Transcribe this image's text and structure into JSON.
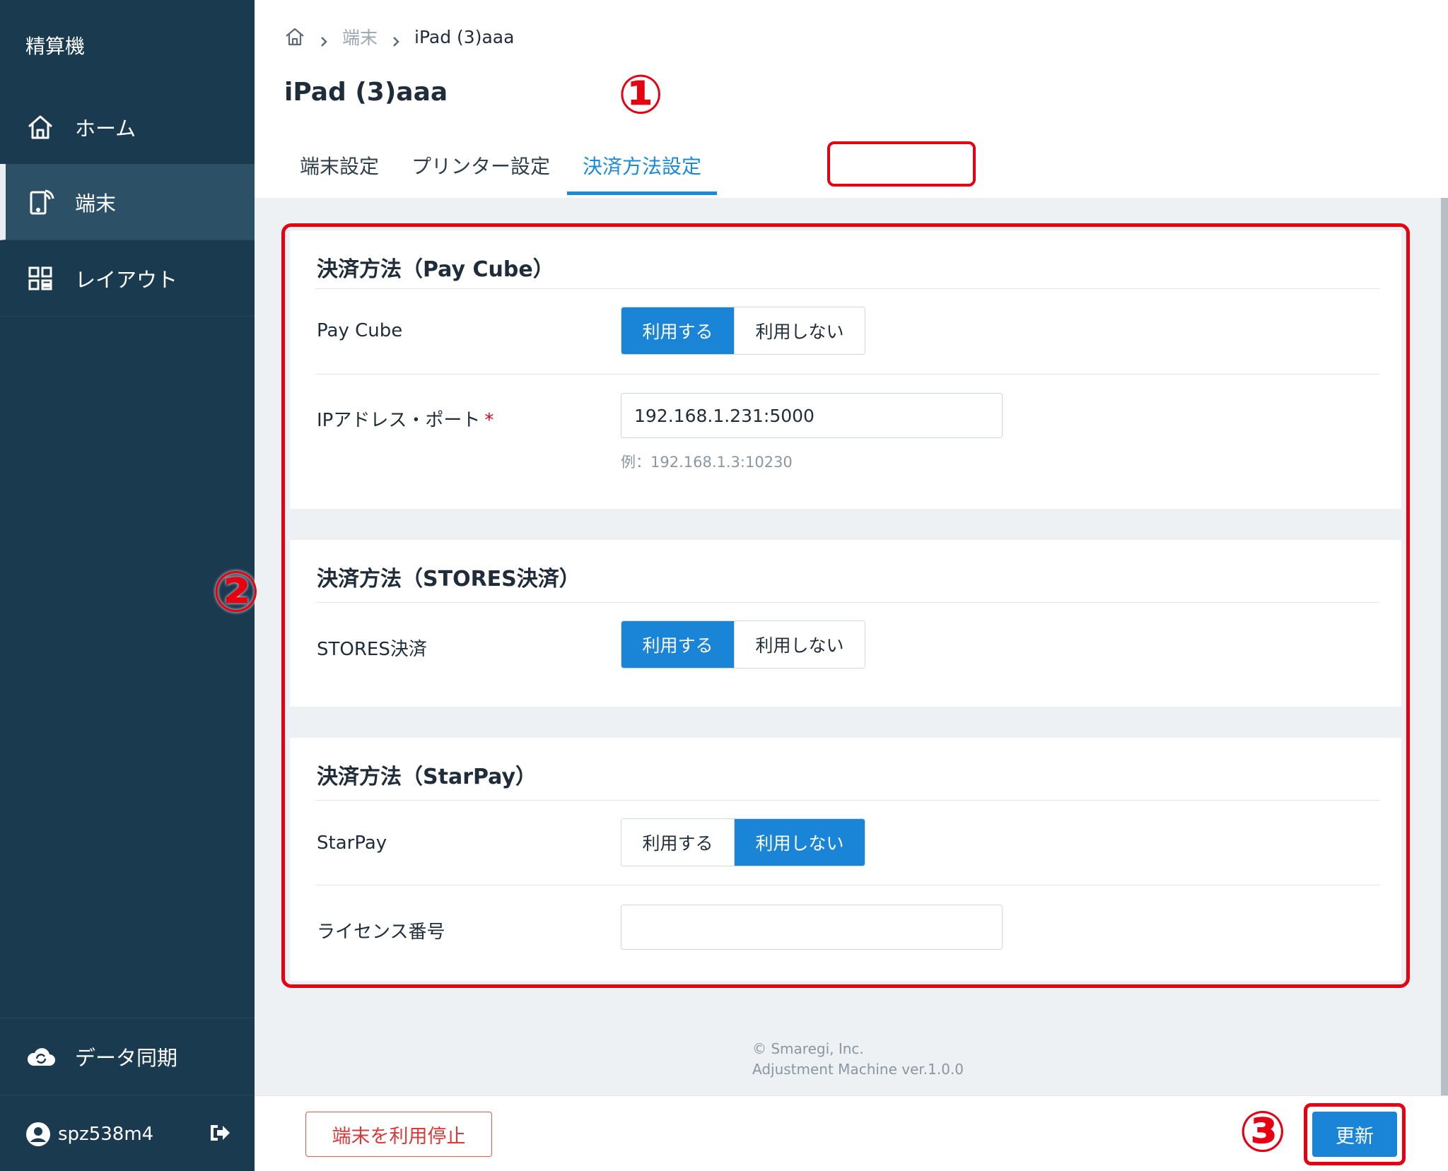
{
  "sidebar": {
    "app_title": "精算機",
    "items": [
      {
        "label": "ホーム",
        "icon": "home-icon"
      },
      {
        "label": "端末",
        "icon": "tablet-icon"
      },
      {
        "label": "レイアウト",
        "icon": "layout-grid-icon"
      }
    ],
    "sync_label": "データ同期",
    "user_name": "spz538m4"
  },
  "breadcrumb": {
    "parent": "端末",
    "current": "iPad (3)aaa"
  },
  "page_title": "iPad (3)aaa",
  "tabs": [
    {
      "label": "端末設定",
      "active": false
    },
    {
      "label": "プリンター設定",
      "active": false
    },
    {
      "label": "決済方法設定",
      "active": true
    }
  ],
  "markers": {
    "one": "①",
    "two": "②",
    "three": "③"
  },
  "sections": {
    "paycube": {
      "title": "決済方法（Pay Cube）",
      "field_label": "Pay Cube",
      "opt_use": "利用する",
      "opt_not_use": "利用しない",
      "selected": "利用する",
      "ip_label": "IPアドレス・ポート",
      "required_mark": "*",
      "ip_value": "192.168.1.231:5000",
      "ip_hint": "例：192.168.1.3:10230"
    },
    "stores": {
      "title": "決済方法（STORES決済）",
      "field_label": "STORES決済",
      "opt_use": "利用する",
      "opt_not_use": "利用しない",
      "selected": "利用する"
    },
    "starpay": {
      "title": "決済方法（StarPay）",
      "field_label": "StarPay",
      "opt_use": "利用する",
      "opt_not_use": "利用しない",
      "selected": "利用しない",
      "license_label": "ライセンス番号",
      "license_value": ""
    }
  },
  "footer": {
    "copyright": "© Smaregi, Inc.",
    "version": "Adjustment Machine ver.1.0.0"
  },
  "actions": {
    "stop_label": "端末を利用停止",
    "update_label": "更新"
  },
  "colors": {
    "sidebar_bg": "#1a3b4f",
    "accent": "#1a84d6",
    "annotation_red": "#e60012"
  }
}
